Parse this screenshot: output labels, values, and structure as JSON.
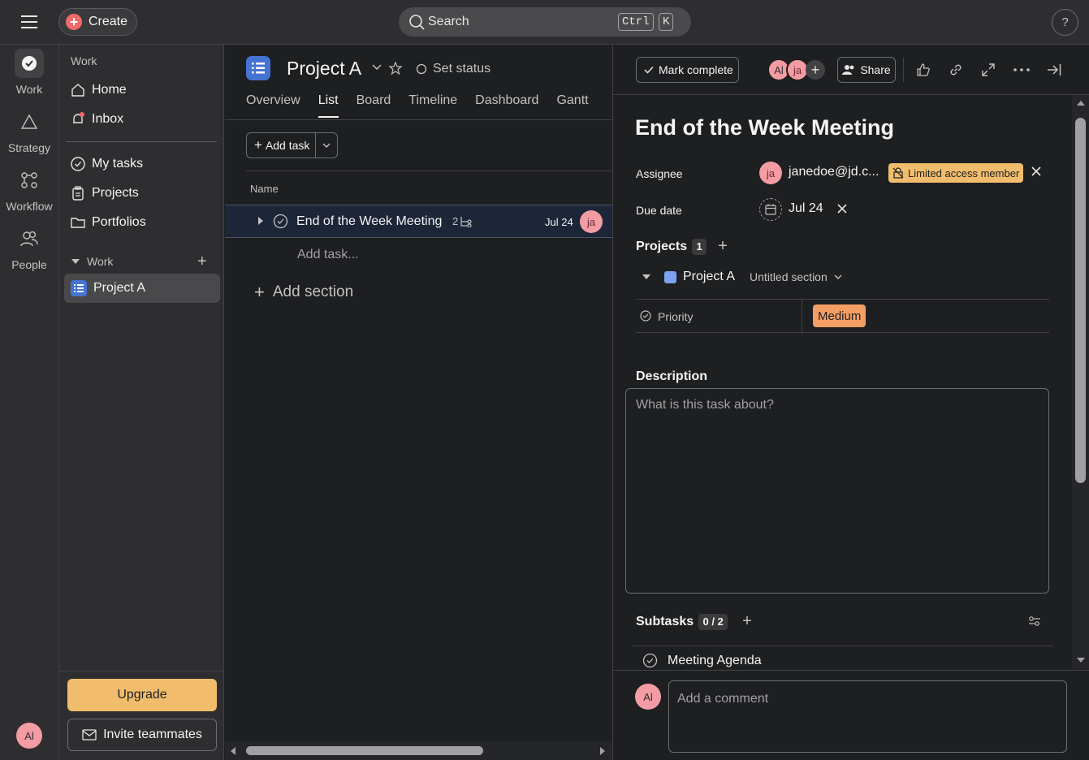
{
  "topbar": {
    "create_label": "Create",
    "search_placeholder": "Search",
    "shortcut_key1": "Ctrl",
    "shortcut_key2": "K",
    "help_label": "?"
  },
  "rail": {
    "items": [
      {
        "label": "Work",
        "icon": "check-circle-icon"
      },
      {
        "label": "Strategy",
        "icon": "triangle-icon"
      },
      {
        "label": "Workflow",
        "icon": "workflow-icon"
      },
      {
        "label": "People",
        "icon": "people-icon"
      }
    ],
    "user_initials": "Al"
  },
  "sidebar": {
    "heading": "Work",
    "nav": [
      {
        "label": "Home",
        "icon": "home-icon"
      },
      {
        "label": "Inbox",
        "icon": "bell-icon"
      },
      {
        "label": "My tasks",
        "icon": "check-circle-icon"
      },
      {
        "label": "Projects",
        "icon": "clipboard-icon"
      },
      {
        "label": "Portfolios",
        "icon": "folder-icon"
      }
    ],
    "section_label": "Work",
    "project_label": "Project A",
    "upgrade_label": "Upgrade",
    "invite_label": "Invite teammates"
  },
  "project": {
    "title": "Project A",
    "status_label": "Set status",
    "tabs": [
      "Overview",
      "List",
      "Board",
      "Timeline",
      "Dashboard",
      "Gantt"
    ],
    "active_tab": "List",
    "add_task_label": "Add task",
    "column_name": "Name",
    "task": {
      "name": "End of the Week Meeting",
      "subtask_count": "2",
      "due": "Jul 24",
      "assignee_initials": "ja"
    },
    "add_task_inline": "Add task...",
    "add_section_label": "Add section"
  },
  "detail": {
    "mark_complete_label": "Mark complete",
    "collaborators": [
      "Al",
      "ja"
    ],
    "share_label": "Share",
    "title": "End of the Week Meeting",
    "assignee_label": "Assignee",
    "assignee_initials": "ja",
    "assignee_name": "janedoe@jd.c...",
    "limited_label": "Limited access member",
    "due_label": "Due date",
    "due_value": "Jul 24",
    "projects_label": "Projects",
    "projects_count": "1",
    "project_name": "Project A",
    "section_name": "Untitled section",
    "priority_label": "Priority",
    "priority_value": "Medium",
    "description_label": "Description",
    "description_placeholder": "What is this task about?",
    "subtasks_label": "Subtasks",
    "subtasks_count": "0 / 2",
    "subtask_first": "Meeting Agenda",
    "comment_avatar": "Al",
    "comment_placeholder": "Add a comment"
  },
  "colors": {
    "accent_red": "#f06a6a",
    "project_blue": "#4573d2",
    "upgrade_orange": "#f1bd6c",
    "priority_orange": "#f59e63",
    "avatar_pink": "#f49ca3"
  }
}
